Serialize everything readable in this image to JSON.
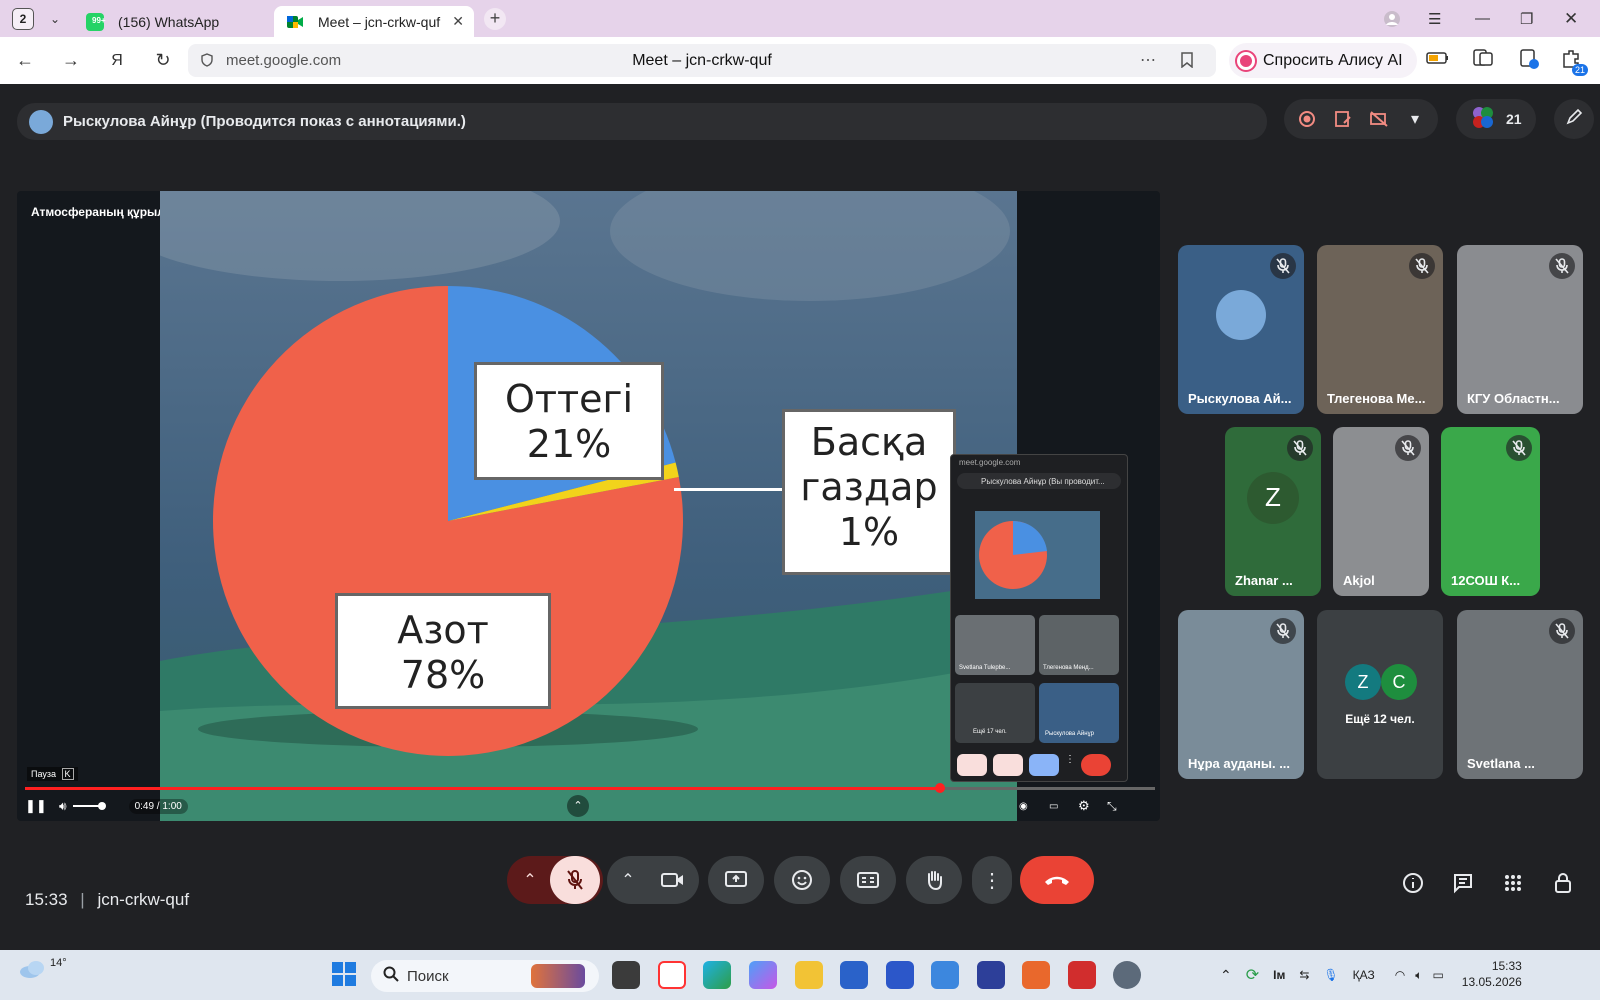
{
  "browser": {
    "tab_count": "2",
    "tabs": [
      {
        "label": "(156) WhatsApp",
        "badge": "99+"
      },
      {
        "label": "Meet – jcn-crkw-quf"
      }
    ],
    "url": "meet.google.com",
    "page_title": "Meet – jcn-crkw-quf",
    "alice_label": "Спросить Алису AI",
    "extension_badge": "21"
  },
  "meet": {
    "presenter_text": "Рыскулова Айнұр (Проводится показ с аннотациями.)",
    "participants_count": "21",
    "slide": {
      "title": "Атмосфераның құрылымы мен ауа құрамы",
      "labels": {
        "oxygen": [
          "Оттегі",
          "21%"
        ],
        "other": [
          "Басқа",
          "газдар",
          "1%"
        ],
        "nitrogen": [
          "Азот",
          "78%"
        ]
      }
    },
    "chart_data": {
      "type": "pie",
      "categories": [
        "Азот",
        "Оттегі",
        "Басқа газдар"
      ],
      "values": [
        78,
        21,
        1
      ],
      "title": "Атмосфераның құрылымы мен ауа құрамы",
      "colors": [
        "#f0614a",
        "#4a90e2",
        "#f2d31b"
      ]
    },
    "video": {
      "pause_label": "Пауза",
      "pause_key": "K",
      "time": "0:49 / 1:00",
      "progress": 0.81
    },
    "pip": {
      "url": "meet.google.com",
      "presenter": "Рыскулова Айнұр (Вы проводит...",
      "tiles": [
        "Svetlana Tulepbe...",
        "Тлегенова Менд..."
      ],
      "more": "Ещё 17 чел.",
      "self": "Рыскулова Айнұр"
    },
    "participants": [
      {
        "name": "Рыскулова Ай..."
      },
      {
        "name": "Тлегенова Ме..."
      },
      {
        "name": "КГУ Областн..."
      },
      {
        "name": "Zhanar ...",
        "initial": "Z"
      },
      {
        "name": "Akjol"
      },
      {
        "name": "12СОШ К..."
      },
      {
        "name": "Нұра ауданы. ..."
      },
      {
        "name": "Ещё 12 чел.",
        "initials": [
          "Z",
          "C"
        ]
      },
      {
        "name": "Svetlana ..."
      }
    ],
    "clock": "15:33",
    "meeting_code": "jcn-crkw-quf"
  },
  "taskbar": {
    "weather": "14°",
    "search_placeholder": "Поиск",
    "lang": "ҚАЗ",
    "time": "15:33",
    "date": "13.05.2026"
  },
  "colors": {
    "accent_blue": "#1a73e8",
    "hangup_red": "#ea4335",
    "mute_pink": "#f9dedc"
  }
}
